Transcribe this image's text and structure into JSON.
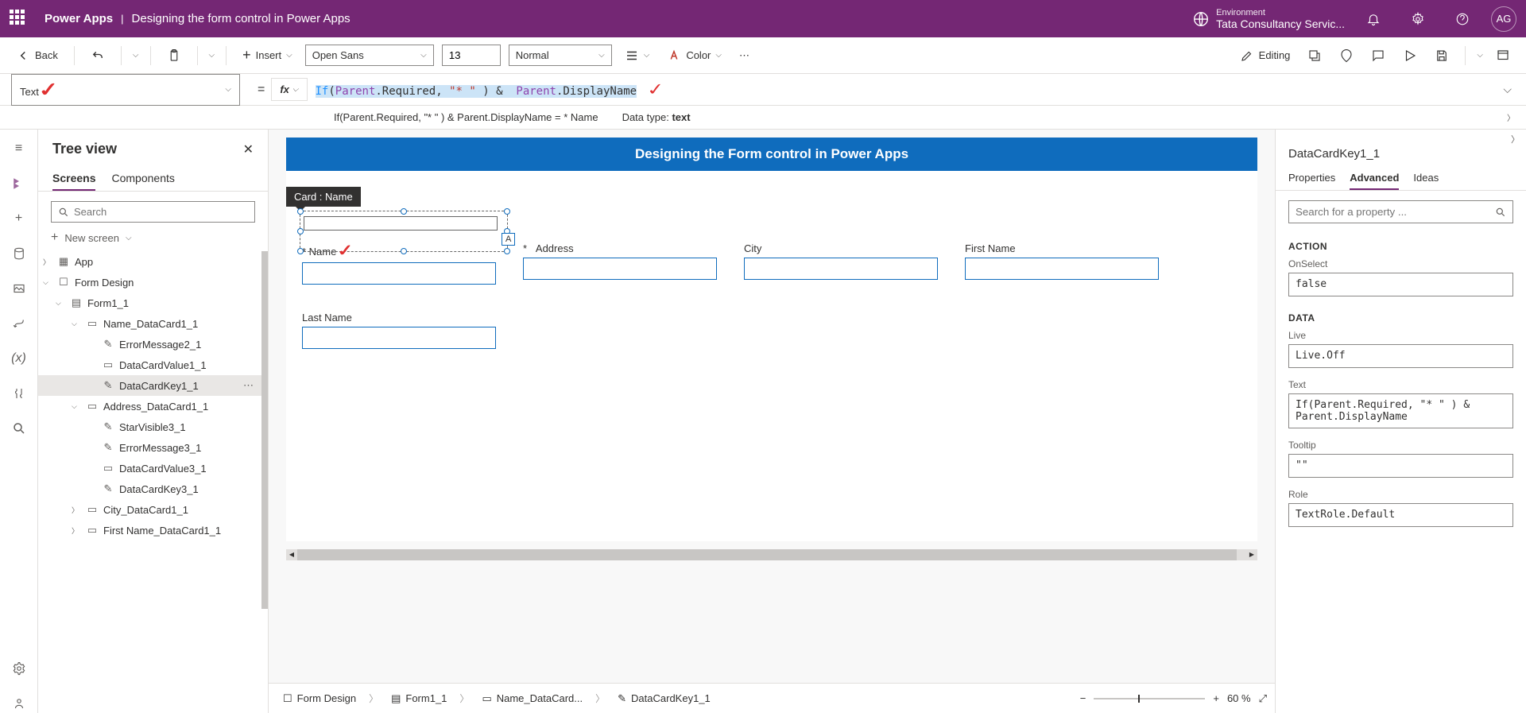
{
  "header": {
    "app": "Power Apps",
    "page": "Designing the form control in Power Apps",
    "env_label": "Environment",
    "env_name": "Tata Consultancy Servic...",
    "avatar": "AG"
  },
  "toolbar": {
    "back": "Back",
    "insert": "Insert",
    "font": "Open Sans",
    "size": "13",
    "weight": "Normal",
    "color": "Color",
    "editing": "Editing"
  },
  "formula": {
    "property": "Text",
    "fx": "fx",
    "raw": "If(Parent.Required, \"* \" ) & Parent.DisplayName",
    "result_label": "If(Parent.Required, \"* \" ) & Parent.DisplayName  =  * Name",
    "datatype_label": "Data type:",
    "datatype": "text"
  },
  "tree": {
    "title": "Tree view",
    "tabs": {
      "screens": "Screens",
      "components": "Components"
    },
    "search_placeholder": "Search",
    "new_screen": "New screen",
    "items": {
      "app": "App",
      "form_design": "Form Design",
      "form1": "Form1_1",
      "name_dc": "Name_DataCard1_1",
      "err2": "ErrorMessage2_1",
      "dcv1": "DataCardValue1_1",
      "dck1": "DataCardKey1_1",
      "addr_dc": "Address_DataCard1_1",
      "star3": "StarVisible3_1",
      "err3": "ErrorMessage3_1",
      "dcv3": "DataCardValue3_1",
      "dck3": "DataCardKey3_1",
      "city_dc": "City_DataCard1_1",
      "fname_dc": "First Name_DataCard1_1"
    }
  },
  "canvas": {
    "title": "Designing the Form control in Power Apps",
    "card_tag": "Card : Name",
    "fields": {
      "name": "* Name",
      "address": "Address",
      "address_star": "*",
      "city": "City",
      "fname": "First Name",
      "lname": "Last Name"
    },
    "a_badge": "A"
  },
  "breadcrumb": {
    "b1": "Form Design",
    "b2": "Form1_1",
    "b3": "Name_DataCard...",
    "b4": "DataCardKey1_1",
    "zoom": "60  %"
  },
  "props": {
    "name": "DataCardKey1_1",
    "tabs": {
      "props": "Properties",
      "adv": "Advanced",
      "ideas": "Ideas"
    },
    "search_placeholder": "Search for a property ...",
    "sections": {
      "action": "ACTION",
      "data": "DATA"
    },
    "onselect_l": "OnSelect",
    "onselect_v": "false",
    "live_l": "Live",
    "live_v": "Live.Off",
    "text_l": "Text",
    "text_v": "If(Parent.Required, \"* \" ) & Parent.DisplayName",
    "tooltip_l": "Tooltip",
    "tooltip_v": "\"\"",
    "role_l": "Role",
    "role_v": "TextRole.Default"
  }
}
